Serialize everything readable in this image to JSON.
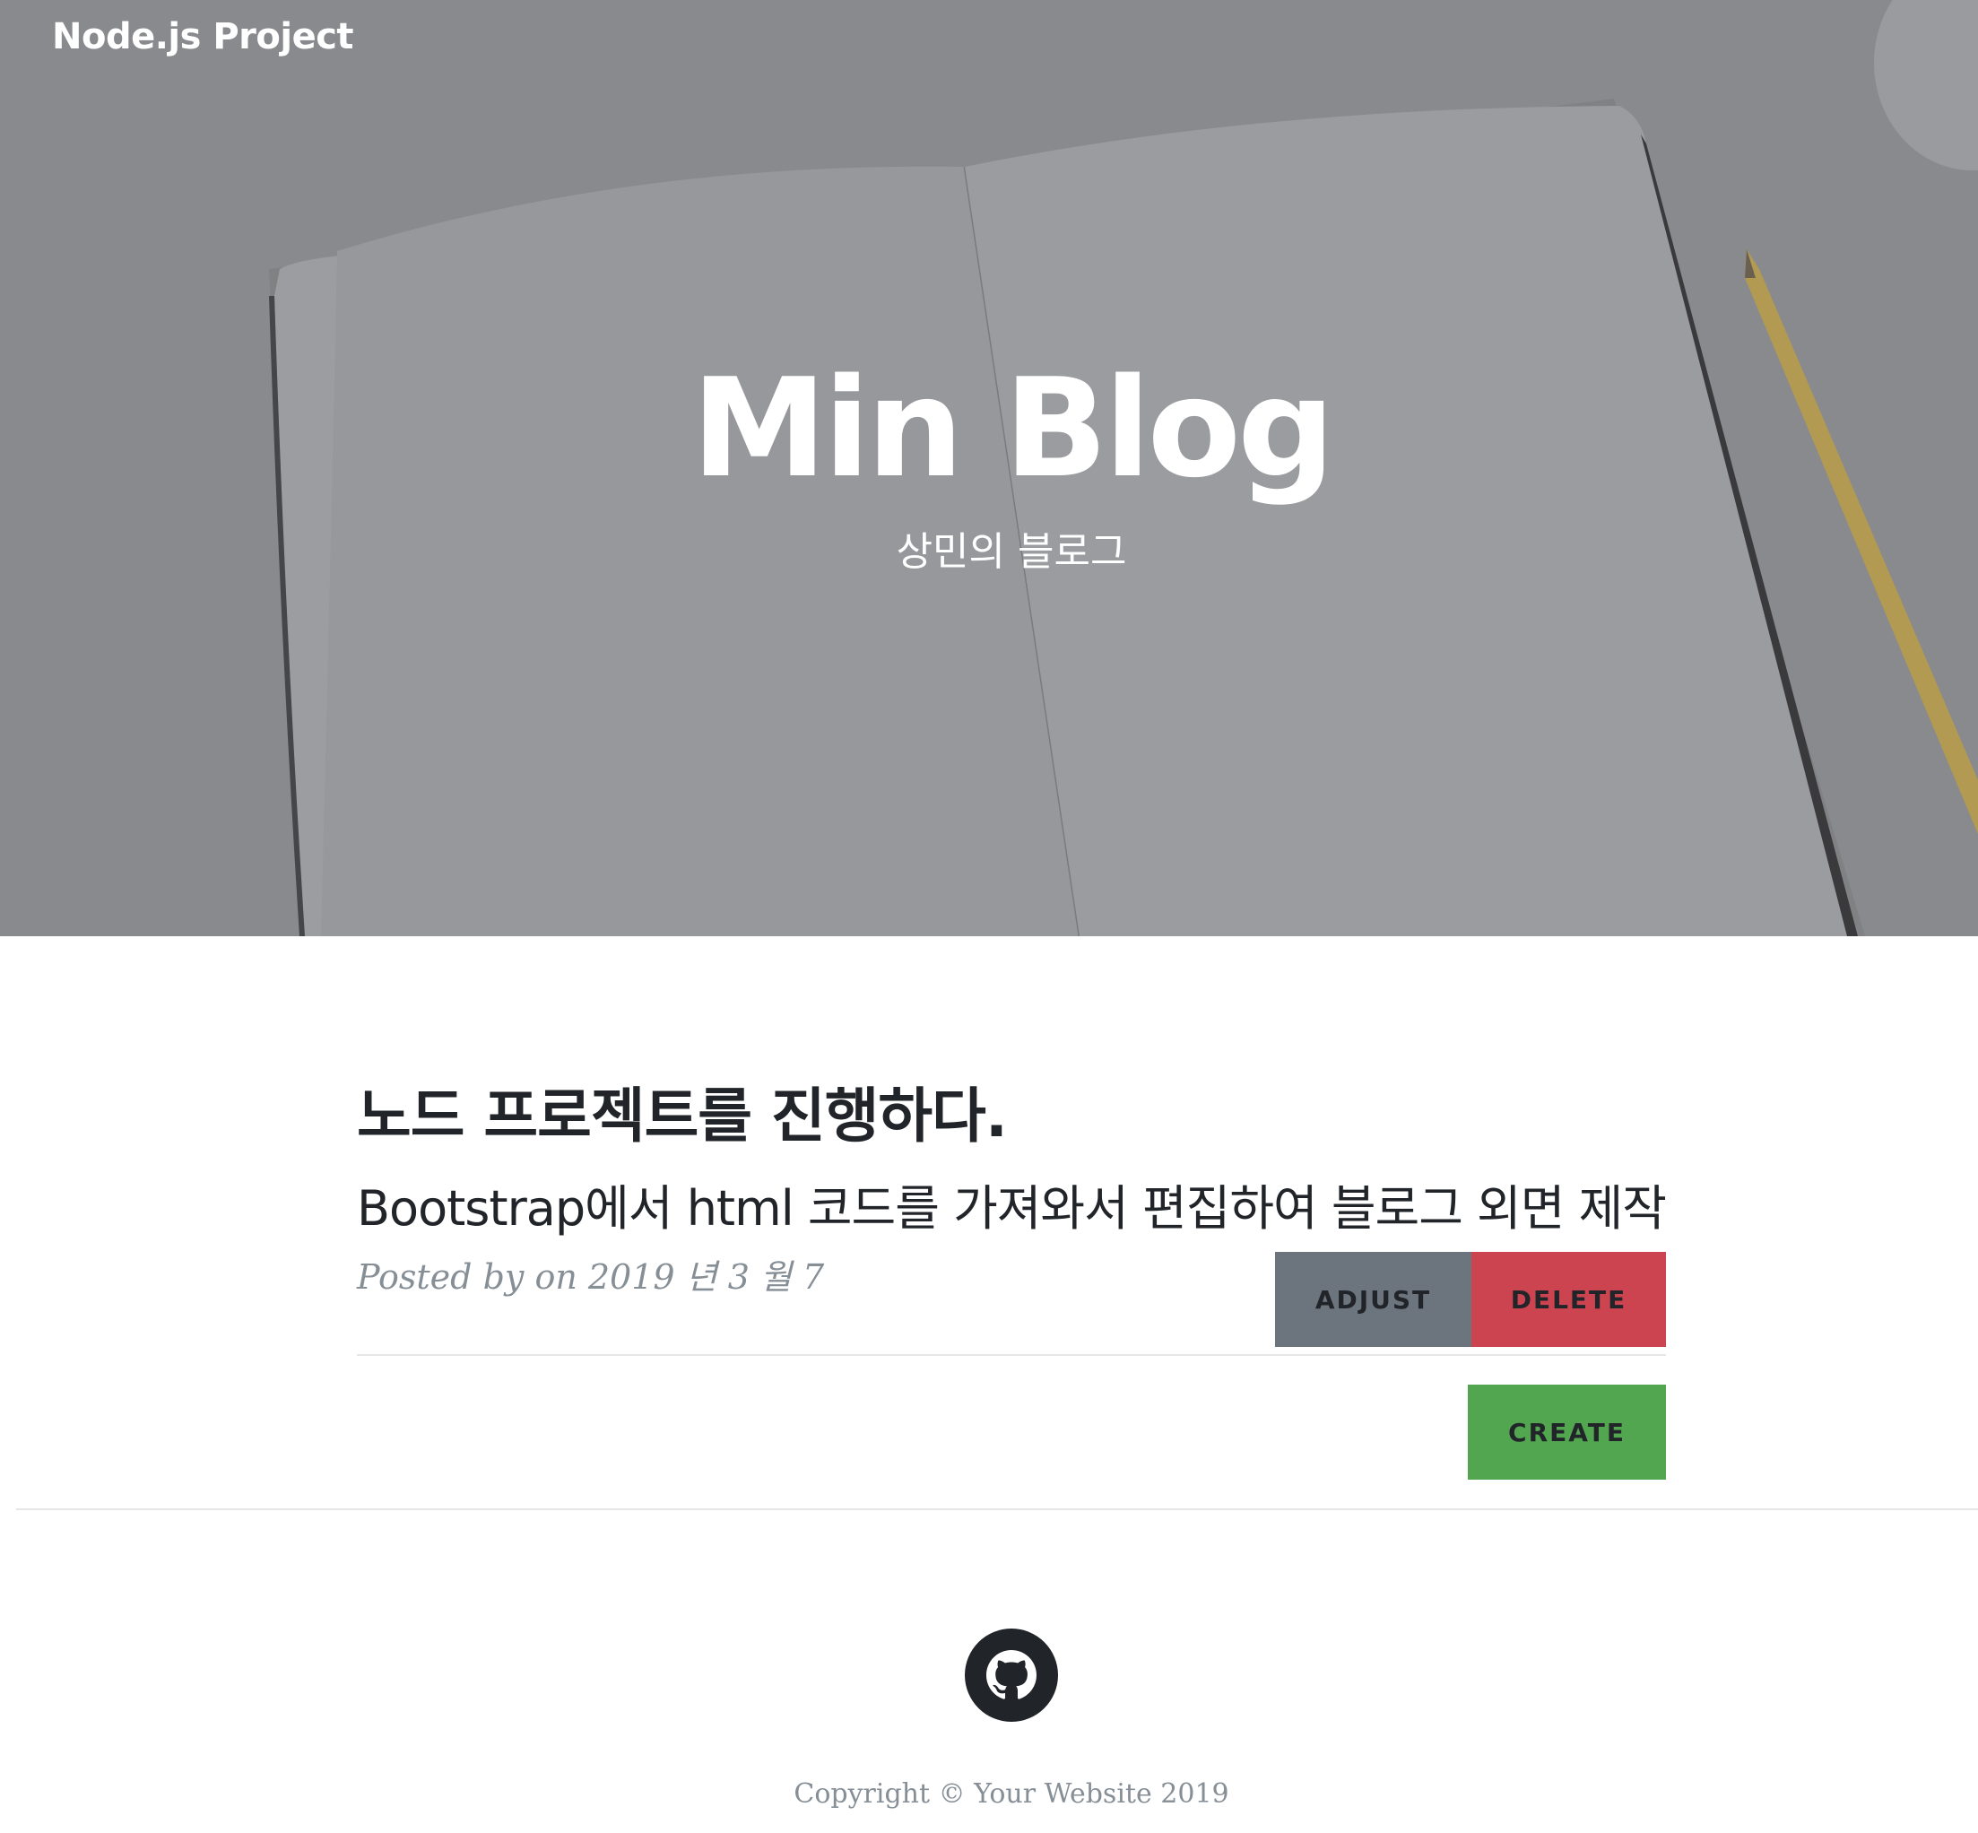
{
  "navbar": {
    "brand": "Node.js Project"
  },
  "hero": {
    "title": "Min Blog",
    "subtitle": "상민의 블로그",
    "overlay_color": "#86878b"
  },
  "post": {
    "title": "노드 프로젝트를 진행하다.",
    "subtitle": "Bootstrap에서 html 코드를 가져와서 편집하여 블로그 외면 제작",
    "meta": "Posted by on 2019 년 3 월 7"
  },
  "actions": {
    "adjust_label": "ADJUST",
    "delete_label": "DELETE",
    "create_label": "CREATE",
    "adjust_color": "#6c757d",
    "delete_color": "#cc4450",
    "create_color": "#52a650"
  },
  "footer": {
    "social_icon": "github-icon",
    "copyright": "Copyright © Your Website 2019"
  }
}
